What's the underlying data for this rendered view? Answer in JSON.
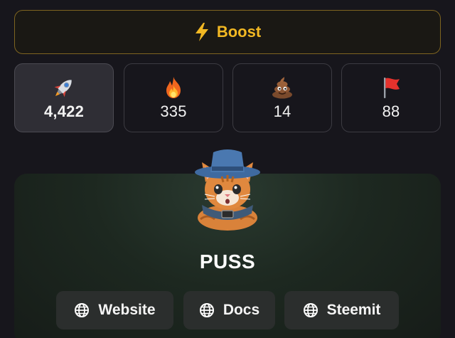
{
  "boost": {
    "label": "Boost",
    "icon": "lightning-bolt-icon",
    "color": "#f2b823"
  },
  "stats": [
    {
      "icon": "rocket-icon",
      "count": "4,422",
      "active": true
    },
    {
      "icon": "fire-icon",
      "count": "335",
      "active": false
    },
    {
      "icon": "poop-icon",
      "count": "14",
      "active": false
    },
    {
      "icon": "red-flag-icon",
      "count": "88",
      "active": false
    }
  ],
  "token": {
    "name": "PUSS",
    "avatar": "cat-in-hat-avatar"
  },
  "links": [
    {
      "label": "Website",
      "icon": "globe-icon"
    },
    {
      "label": "Docs",
      "icon": "globe-icon"
    },
    {
      "label": "Steemit",
      "icon": "globe-icon"
    }
  ]
}
